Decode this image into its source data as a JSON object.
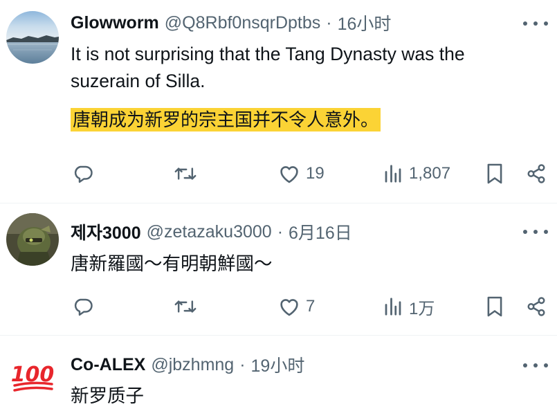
{
  "tweets": [
    {
      "name": "Glowworm",
      "handle": "@Q8Rbf0nsqrDptbs",
      "separator": "·",
      "time": "16小时",
      "text_line1": "It is not surprising that the Tang Dynasty was the",
      "text_line2": "suzerain of Silla.",
      "translation": "唐朝成为新罗的宗主国并不令人意外。",
      "likes": "19",
      "views": "1,807",
      "avatar": "lake-landscape-photo"
    },
    {
      "name": "제자3000",
      "handle": "@zetazaku3000",
      "separator": "·",
      "time": "6月16日",
      "text_line1": "唐新羅國〜有明朝鮮國〜",
      "likes": "7",
      "views": "1万",
      "avatar": "robot-figure-photo"
    },
    {
      "name": "Co-ALEX",
      "handle": "@jbzhmng",
      "separator": "·",
      "time": "19小时",
      "text_line1": "新罗质子",
      "avatar": "hundred-points-emoji",
      "avatar_text": "100"
    }
  ],
  "colors": {
    "text": "#0f1419",
    "secondary": "#536471",
    "highlight": "#fbd335",
    "divider": "#eff3f4",
    "emoji_red": "#e8262c"
  },
  "icons": [
    "reply-icon",
    "retweet-icon",
    "heart-icon",
    "views-icon",
    "bookmark-icon",
    "share-icon",
    "more-icon"
  ]
}
